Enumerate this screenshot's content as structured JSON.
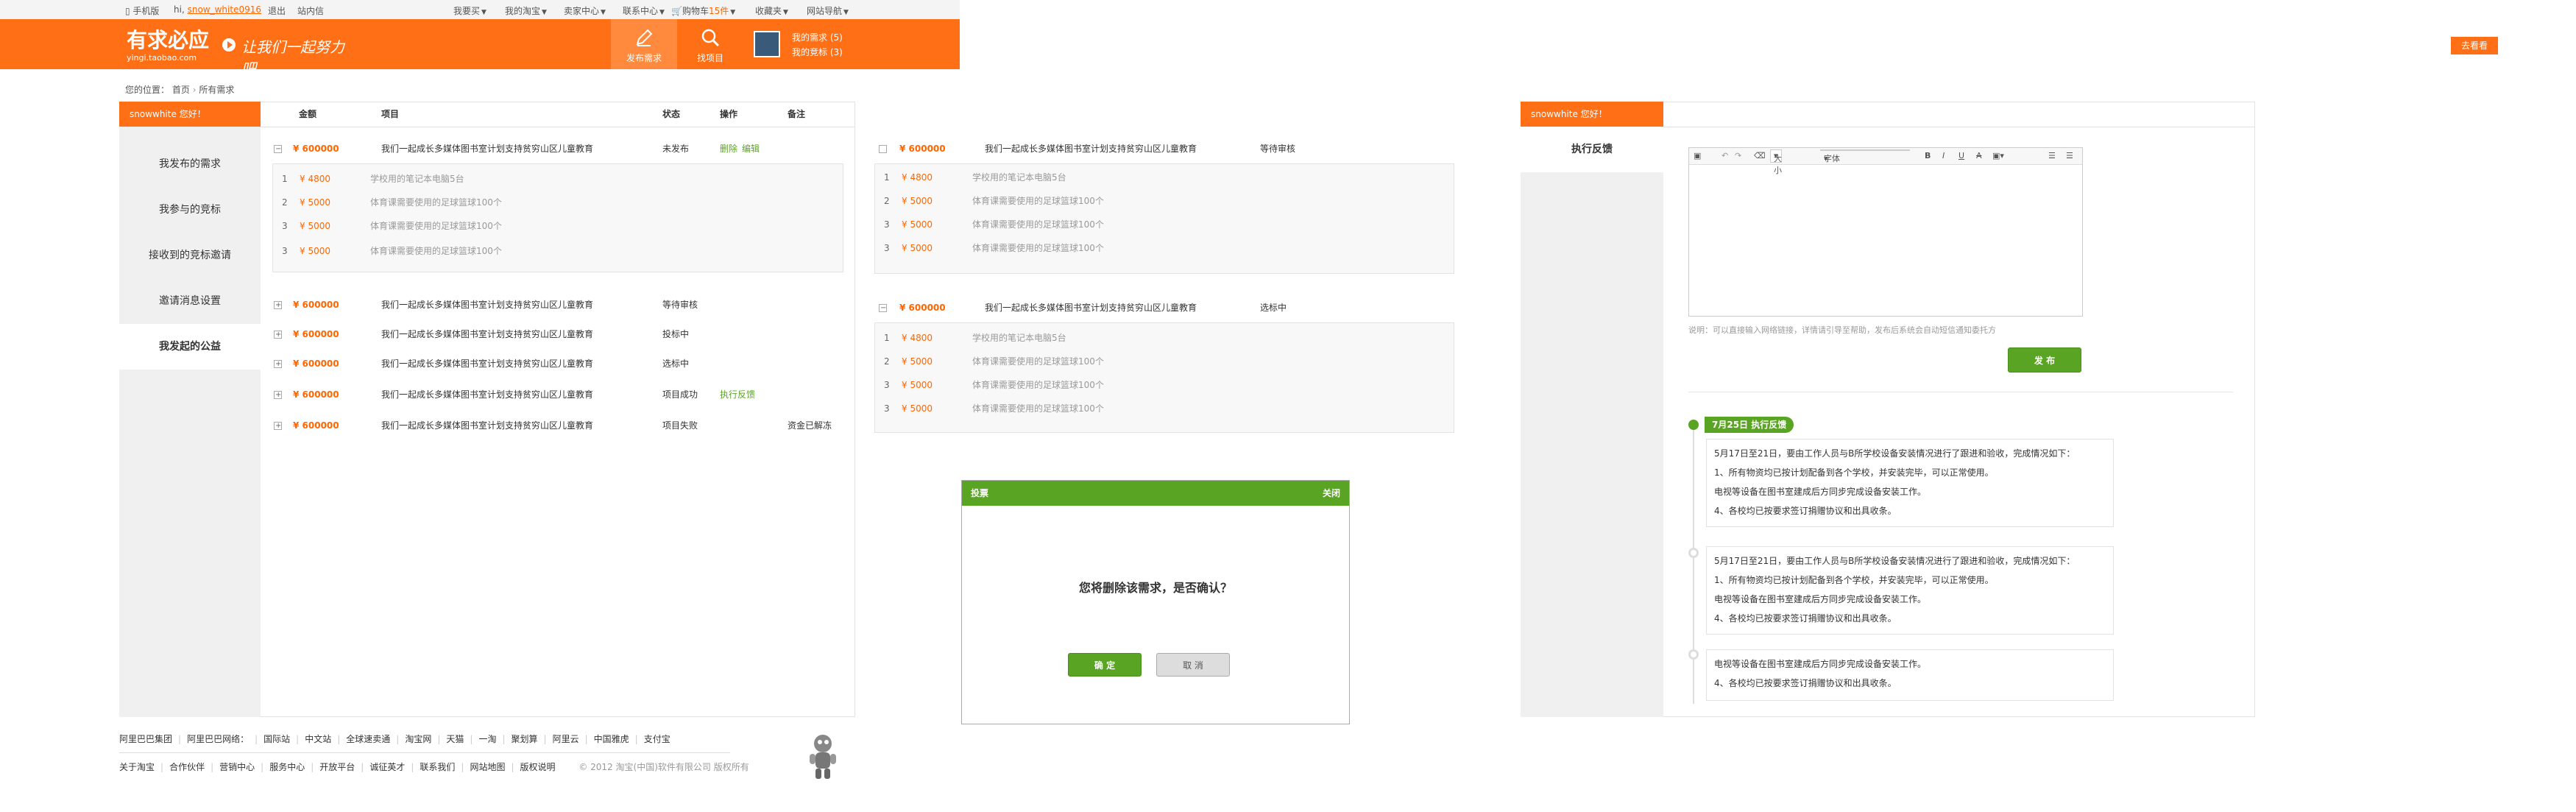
{
  "topbar": {
    "mobile": "手机版",
    "greeting_prefix": "hi,",
    "username": "snow_white0916",
    "logout": "退出",
    "messages": "站内信",
    "buy": "我要买",
    "my_taobao": "我的淘宝",
    "seller_center": "卖家中心",
    "service_center": "联系中心",
    "cart": "购物车",
    "cart_count": "15件",
    "favorites": "收藏夹",
    "site_nav": "网站导航"
  },
  "header": {
    "logo": "有求必应",
    "logo_sub": "yingi.taobao.com",
    "slogan": "让我们一起努力吧",
    "publish_btn": "发布需求",
    "project_btn": "找项目",
    "my_needs": "我的需求 (5)",
    "my_bids": "我的竞标 (3)"
  },
  "breadcrumb": {
    "label": "您的位置：",
    "home": "首页",
    "current": "所有需求"
  },
  "right_btn": "去看看",
  "left_panel": {
    "user_label": "snowwhite  您好！",
    "menu": [
      "我发布的需求",
      "我参与的竞标",
      "接收到的竞标邀请",
      "邀请消息设置",
      "我发起的公益"
    ],
    "active_index": 4,
    "columns": [
      "金额",
      "项目",
      "状态",
      "操作",
      "备注"
    ],
    "rows": [
      {
        "amount": "¥ 600000",
        "title": "我们一起成长多媒体图书室计划支持贫穷山区儿童教育",
        "status": "未发布",
        "op1": "删除",
        "op2": "编辑",
        "note": ""
      },
      {
        "amount": "¥ 600000",
        "title": "我们一起成长多媒体图书室计划支持贫穷山区儿童教育",
        "status": "等待审核",
        "op1": "",
        "op2": "",
        "note": ""
      },
      {
        "amount": "¥ 600000",
        "title": "我们一起成长多媒体图书室计划支持贫穷山区儿童教育",
        "status": "投标中",
        "op1": "",
        "op2": "",
        "note": ""
      },
      {
        "amount": "¥ 600000",
        "title": "我们一起成长多媒体图书室计划支持贫穷山区儿童教育",
        "status": "选标中",
        "op1": "",
        "op2": "",
        "note": ""
      },
      {
        "amount": "¥ 600000",
        "title": "我们一起成长多媒体图书室计划支持贫穷山区儿童教育",
        "status": "项目成功",
        "op1": "执行反馈",
        "op2": "",
        "note": ""
      },
      {
        "amount": "¥ 600000",
        "title": "我们一起成长多媒体图书室计划支持贫穷山区儿童教育",
        "status": "项目失败",
        "op1": "",
        "op2": "",
        "note": "资金已解冻"
      }
    ],
    "sub_items": [
      {
        "n": "1",
        "v": "¥ 4800",
        "d": "学校用的笔记本电脑5台"
      },
      {
        "n": "2",
        "v": "¥ 5000",
        "d": "体育课需要使用的足球篮球100个"
      },
      {
        "n": "3",
        "v": "¥ 5000",
        "d": "体育课需要使用的足球篮球100个"
      },
      {
        "n": "3",
        "v": "¥ 5000",
        "d": "体育课需要使用的足球篮球100个"
      }
    ]
  },
  "middle_panel": {
    "groups": [
      {
        "amount": "¥ 600000",
        "title": "我们一起成长多媒体图书室计划支持贫穷山区儿童教育",
        "status": "等待审核",
        "items": [
          {
            "n": "1",
            "v": "¥ 4800",
            "d": "学校用的笔记本电脑5台"
          },
          {
            "n": "2",
            "v": "¥ 5000",
            "d": "体育课需要使用的足球篮球100个"
          },
          {
            "n": "3",
            "v": "¥ 5000",
            "d": "体育课需要使用的足球篮球100个"
          },
          {
            "n": "3",
            "v": "¥ 5000",
            "d": "体育课需要使用的足球篮球100个"
          }
        ]
      },
      {
        "amount": "¥ 600000",
        "title": "我们一起成长多媒体图书室计划支持贫穷山区儿童教育",
        "status": "选标中",
        "items": [
          {
            "n": "1",
            "v": "¥ 4800",
            "d": "学校用的笔记本电脑5台"
          },
          {
            "n": "2",
            "v": "¥ 5000",
            "d": "体育课需要使用的足球篮球100个"
          },
          {
            "n": "3",
            "v": "¥ 5000",
            "d": "体育课需要使用的足球篮球100个"
          },
          {
            "n": "3",
            "v": "¥ 5000",
            "d": "体育课需要使用的足球篮球100个"
          }
        ]
      }
    ]
  },
  "dialog": {
    "title": "投票",
    "close": "关闭",
    "message": "您将删除该需求，是否确认？",
    "ok": "确 定",
    "cancel": "取 消"
  },
  "footer": {
    "line1": [
      "阿里巴巴集团",
      "阿里巴巴网络：",
      "国际站",
      "中文站",
      "全球速卖通",
      "淘宝网",
      "天猫",
      "一淘",
      "聚划算",
      "阿里云",
      "中国雅虎",
      "支付宝"
    ],
    "line2": [
      "关于淘宝",
      "合作伙伴",
      "营销中心",
      "服务中心",
      "开放平台",
      "诚征英才",
      "联系我们",
      "网站地图",
      "版权说明"
    ],
    "copyright": "© 2012 淘宝(中国)软件有限公司 版权所有"
  },
  "feedback": {
    "user_label": "snowwhite  您好！",
    "menu_item": "执行反馈",
    "toolbar": {
      "size": "大小",
      "font": "字体",
      "bold": "B",
      "italic": "I",
      "underline": "U",
      "strike": "A"
    },
    "hint": "说明：可以直接输入网络链接，详情请引导至帮助，发布后系统会自动短信通知委托方",
    "publish": "发 布",
    "badge": "7月25日  执行反馈",
    "cards": [
      [
        "5月17日至21日，要由工作人员与B所学校设备安装情况进行了跟进和验收，完成情况如下：",
        "1、所有物资均已按计划配备到各个学校，并安装完毕，可以正常使用。",
        "电视等设备在图书室建成后方同步完成设备安装工作。",
        "4、各校均已按要求签订捐赠协议和出具收条。"
      ],
      [
        "5月17日至21日，要由工作人员与B所学校设备安装情况进行了跟进和验收，完成情况如下：",
        "1、所有物资均已按计划配备到各个学校，并安装完毕，可以正常使用。",
        "电视等设备在图书室建成后方同步完成设备安装工作。",
        "4、各校均已按要求签订捐赠协议和出具收条。"
      ],
      [
        "电视等设备在图书室建成后方同步完成设备安装工作。",
        "4、各校均已按要求签订捐赠协议和出具收条。"
      ]
    ]
  },
  "colors": {
    "brand_orange": "#ff6f16",
    "green": "#5aa423"
  }
}
